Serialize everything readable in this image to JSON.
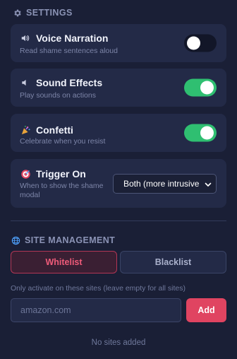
{
  "settings": {
    "heading": "SETTINGS",
    "heading_icon": "gear-icon",
    "items": [
      {
        "title": "Voice Narration",
        "description": "Read shame sentences aloud",
        "icon": "speaker-icon",
        "enabled": false
      },
      {
        "title": "Sound Effects",
        "description": "Play sounds on actions",
        "icon": "speaker-low-icon",
        "enabled": true
      },
      {
        "title": "Confetti",
        "description": "Celebrate when you resist",
        "icon": "party-icon",
        "enabled": true
      }
    ],
    "trigger": {
      "title": "Trigger On",
      "description_line1": "When to show the shame",
      "description_line2": "modal",
      "icon": "target-icon",
      "selected": "Both (more intrusive"
    }
  },
  "site_management": {
    "heading": "SITE MANAGEMENT",
    "heading_icon": "globe-icon",
    "tabs": {
      "whitelist": "Whitelist",
      "blacklist": "Blacklist",
      "active": "Whitelist"
    },
    "hint": "Only activate on these sites (leave empty for all sites)",
    "input_placeholder": "amazon.com",
    "add_label": "Add",
    "empty_text": "No sites added"
  },
  "colors": {
    "background": "#1a1f36",
    "card": "#232a47",
    "toggle_on": "#2fbf71",
    "accent": "#e04461"
  }
}
